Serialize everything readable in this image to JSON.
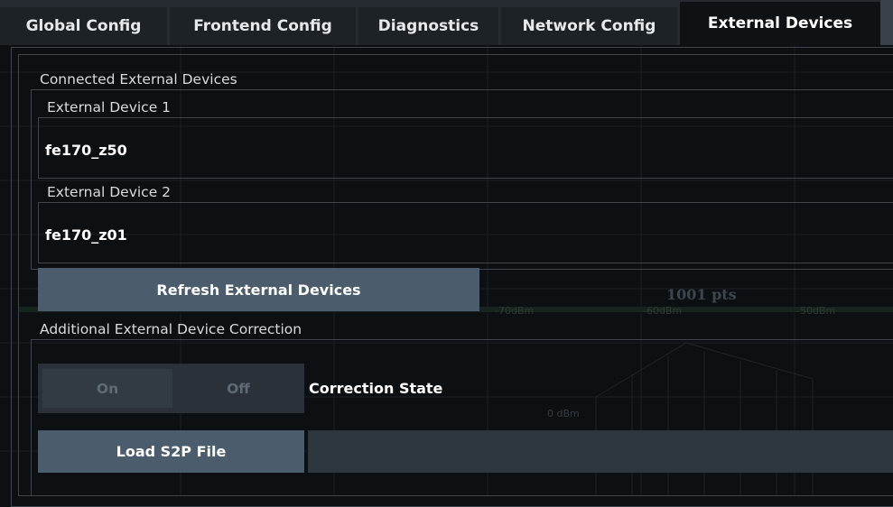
{
  "tabs": [
    {
      "label": "Global Config"
    },
    {
      "label": "Frontend Config"
    },
    {
      "label": "Diagnostics"
    },
    {
      "label": "Network Config"
    },
    {
      "label": "External Devices",
      "active": true
    }
  ],
  "connected": {
    "title": "Connected External Devices",
    "devices": [
      {
        "label": "External Device 1",
        "value": "fe170_z50"
      },
      {
        "label": "External Device 2",
        "value": "fe170_z01"
      }
    ],
    "refresh_label": "Refresh External Devices"
  },
  "correction": {
    "title": "Additional External Device Correction",
    "on_label": "On",
    "off_label": "Off",
    "state_label": "Correction State",
    "load_label": "Load S2P File",
    "file_value": ""
  },
  "background": {
    "pts_label": "1001 pts",
    "scale_labels": [
      "-70dBm",
      "-60dBm",
      "-50dBm"
    ],
    "level_label": "0 dBm"
  },
  "colors": {
    "accent_button": "#4b5d6c",
    "panel_bg": "#0d1013",
    "tab_bar": "#262b31"
  }
}
